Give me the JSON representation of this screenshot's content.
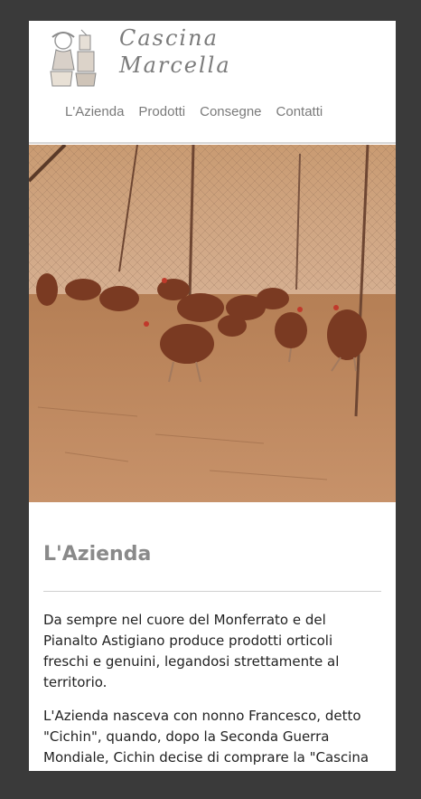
{
  "brand": {
    "line1": "Cascina",
    "line2": "Marcella"
  },
  "nav": {
    "items": [
      "L'Azienda",
      "Prodotti",
      "Consegne",
      "Contatti"
    ]
  },
  "article": {
    "title": "L'Azienda",
    "paragraph1": "Da sempre nel cuore del Monferrato e del Pianalto Astigiano produce prodotti orticoli freschi e genuini, legandosi strettamente al territorio.",
    "paragraph2": "L'Azienda nasceva con nonno Francesco, detto \"Cichin\", quando, dopo la Seconda Guerra Mondiale, Cichin decise di comprare la \"Cascina Marcella\" e dedicarsi alla vita agreste."
  },
  "colors": {
    "background": "#3a3a3a",
    "page": "#ffffff",
    "nav_text": "#7a7a7a",
    "title_text": "#8a8a8a",
    "body_text": "#222222"
  },
  "icons": {
    "logo": "farmer-drawing-logo"
  }
}
